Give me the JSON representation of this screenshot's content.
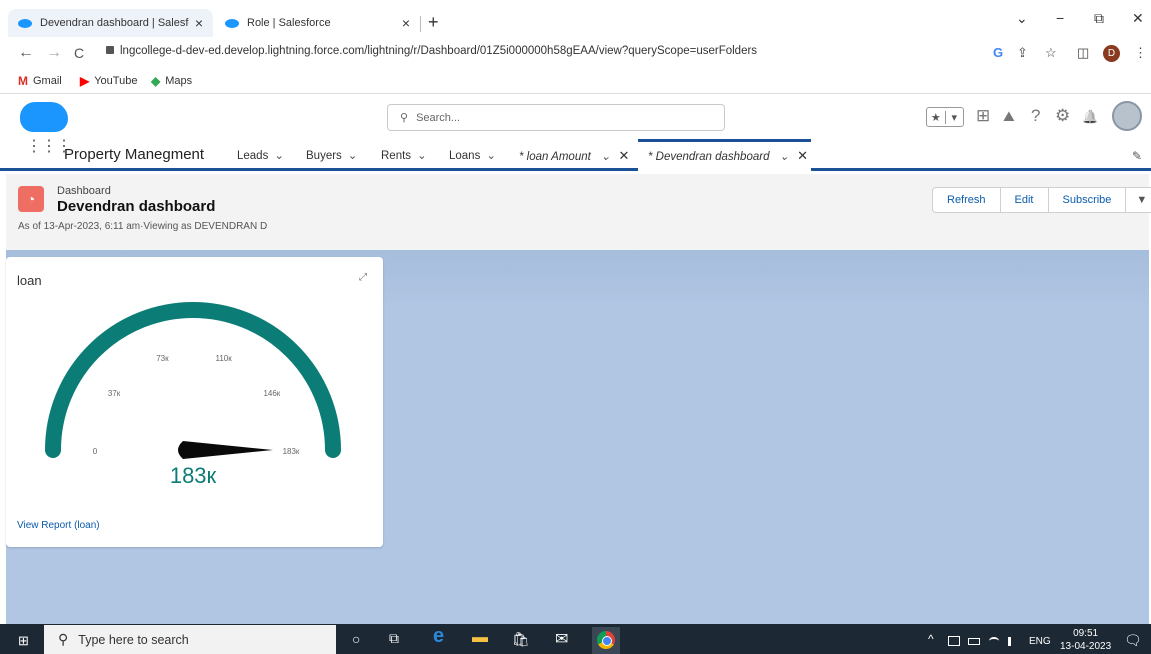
{
  "browser": {
    "tabs": [
      {
        "title": "Devendran dashboard | Salesforc",
        "active": true
      },
      {
        "title": "Role | Salesforce",
        "active": false
      }
    ],
    "new_tab": "+",
    "close_glyph": "×",
    "window_controls": {
      "dropdown": "⌄",
      "minimize": "−",
      "restore": "⧉",
      "close": "✕"
    },
    "nav": {
      "back": "←",
      "forward": "→",
      "reload": "C"
    },
    "url": "lngcollege-d-dev-ed.develop.lightning.force.com/lightning/r/Dashboard/01Z5i000000h58gEAA/view?queryScope=userFolders",
    "profile_initial": "D",
    "right_icons": {
      "google": "G",
      "share": "⇪",
      "star": "☆",
      "sidebar": "◫",
      "menu": "⋮"
    },
    "bookmarks": [
      {
        "label": "Gmail",
        "icon": "gmail-icon",
        "glyph": "M",
        "color": "#d93025"
      },
      {
        "label": "YouTube",
        "icon": "youtube-icon",
        "glyph": "▶",
        "color": "#ff0000"
      },
      {
        "label": "Maps",
        "icon": "maps-icon",
        "glyph": "◆",
        "color": "#34a853"
      }
    ]
  },
  "salesforce": {
    "search_placeholder": "Search...",
    "search_glyph": "⚲",
    "header_icons": {
      "star": "★",
      "caret": "▾",
      "add": "⊞",
      "trailhead": "⛰",
      "help": "?",
      "setup": "⚙",
      "bell": "🔔"
    },
    "app_name": "Property Manegment",
    "waffle": "⋮⋮⋮",
    "nav_items": [
      {
        "label": "Leads",
        "chevron": "⌄"
      },
      {
        "label": "Buyers",
        "chevron": "⌄"
      },
      {
        "label": "Rents",
        "chevron": "⌄"
      },
      {
        "label": "Loans",
        "chevron": "⌄"
      }
    ],
    "open_tabs": [
      {
        "label": "* loan Amount",
        "chevron": "⌄",
        "close": "✕"
      },
      {
        "label": "* Devendran dashboard",
        "chevron": "⌄",
        "close": "✕"
      }
    ],
    "edit_glyph": "✎"
  },
  "dashboard": {
    "icon_glyph": "◔",
    "type_label": "Dashboard",
    "name": "Devendran dashboard",
    "subtitle": "As of 13-Apr-2023, 6:11 am·Viewing as DEVENDRAN D",
    "buttons": {
      "refresh": "Refresh",
      "edit": "Edit",
      "subscribe": "Subscribe",
      "more": "▼"
    }
  },
  "widget": {
    "title": "loan",
    "expand_glyph": "⤢",
    "link": "View Report (loan)",
    "accent": "#0c7d76"
  },
  "chart_data": {
    "type": "gauge",
    "min": 0,
    "max": 183000,
    "value": 183000,
    "value_label": "183к",
    "tick_labels": [
      "0",
      "37к",
      "73к",
      "110к",
      "146к",
      "183к"
    ],
    "tick_values": [
      0,
      37000,
      73000,
      110000,
      146000,
      183000
    ],
    "color": "#0c7d76"
  },
  "taskbar": {
    "start_glyph": "⊞",
    "search_glyph": "⚲",
    "search_placeholder": "Type here to search",
    "apps": {
      "cortana": "○",
      "taskview": "⧉",
      "edge": "e",
      "explorer": "▬",
      "store": "🛍",
      "mail": "✉"
    },
    "tray": {
      "chevron": "^",
      "lang": "ENG"
    },
    "time": "09:51",
    "date": "13-04-2023",
    "notification_glyph": "🗨"
  }
}
